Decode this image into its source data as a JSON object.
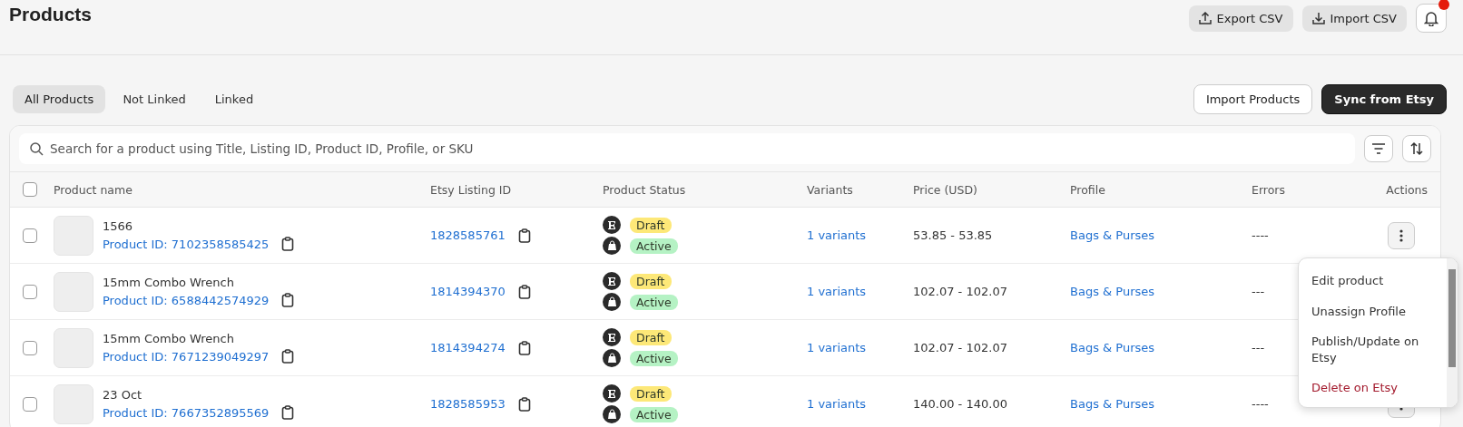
{
  "page": {
    "title": "Products"
  },
  "header_buttons": [
    {
      "label": "Export CSV",
      "kind": "export"
    },
    {
      "label": "Import CSV",
      "kind": "import"
    }
  ],
  "notifications": {
    "unread": true
  },
  "tabs": [
    {
      "label": "All Products",
      "selected": true
    },
    {
      "label": "Not Linked",
      "selected": false
    },
    {
      "label": "Linked",
      "selected": false
    }
  ],
  "actions": [
    {
      "label": "Import Products",
      "kind": "secondary"
    },
    {
      "label": "Sync from Etsy",
      "kind": "primary"
    }
  ],
  "search": {
    "placeholder": "Search for a product using Title, Listing ID, Product ID, Profile, or SKU"
  },
  "table": {
    "select_all": {
      "checked": false
    },
    "columns": [
      "Product name",
      "Etsy Listing ID",
      "Product Status",
      "Variants",
      "Price (USD)",
      "Profile",
      "Errors",
      "Actions"
    ],
    "rows": [
      {
        "checked": false,
        "name": "1566",
        "product_id": "Product ID: 7102358585425",
        "listing_id": "1828585761",
        "statuses": [
          {
            "kind": "etsy",
            "label": "Draft",
            "color": "#fde878"
          },
          {
            "kind": "shop",
            "label": "Active",
            "color": "#b5f2c4"
          }
        ],
        "variants": "1 variants",
        "price": "53.85 - 53.85",
        "profile": "Bags & Purses",
        "errors": "----"
      },
      {
        "checked": false,
        "name": "15mm Combo Wrench",
        "product_id": "Product ID: 6588442574929",
        "listing_id": "1814394370",
        "statuses": [
          {
            "kind": "etsy",
            "label": "Draft",
            "color": "#fde878"
          },
          {
            "kind": "shop",
            "label": "Active",
            "color": "#b5f2c4"
          }
        ],
        "variants": "1 variants",
        "price": "102.07 - 102.07",
        "profile": "Bags & Purses",
        "errors": "---"
      },
      {
        "checked": false,
        "name": "15mm Combo Wrench",
        "product_id": "Product ID: 7671239049297",
        "listing_id": "1814394274",
        "statuses": [
          {
            "kind": "etsy",
            "label": "Draft",
            "color": "#fde878"
          },
          {
            "kind": "shop",
            "label": "Active",
            "color": "#b5f2c4"
          }
        ],
        "variants": "1 variants",
        "price": "102.07 - 102.07",
        "profile": "Bags & Purses",
        "errors": "---"
      },
      {
        "checked": false,
        "name": "23 Oct",
        "product_id": "Product ID: 7667352895569",
        "listing_id": "1828585953",
        "statuses": [
          {
            "kind": "etsy",
            "label": "Draft",
            "color": "#fde878"
          },
          {
            "kind": "shop",
            "label": "Active",
            "color": "#b5f2c4"
          }
        ],
        "variants": "1 variants",
        "price": "140.00 - 140.00",
        "profile": "Bags & Purses",
        "errors": "----"
      }
    ]
  },
  "action_menu": {
    "items": [
      {
        "label": "Edit product",
        "kind": "normal"
      },
      {
        "label": "Unassign Profile",
        "kind": "normal"
      },
      {
        "label": "Publish/Update on Etsy",
        "kind": "normal"
      },
      {
        "label": "Delete on Etsy",
        "kind": "danger"
      }
    ]
  }
}
